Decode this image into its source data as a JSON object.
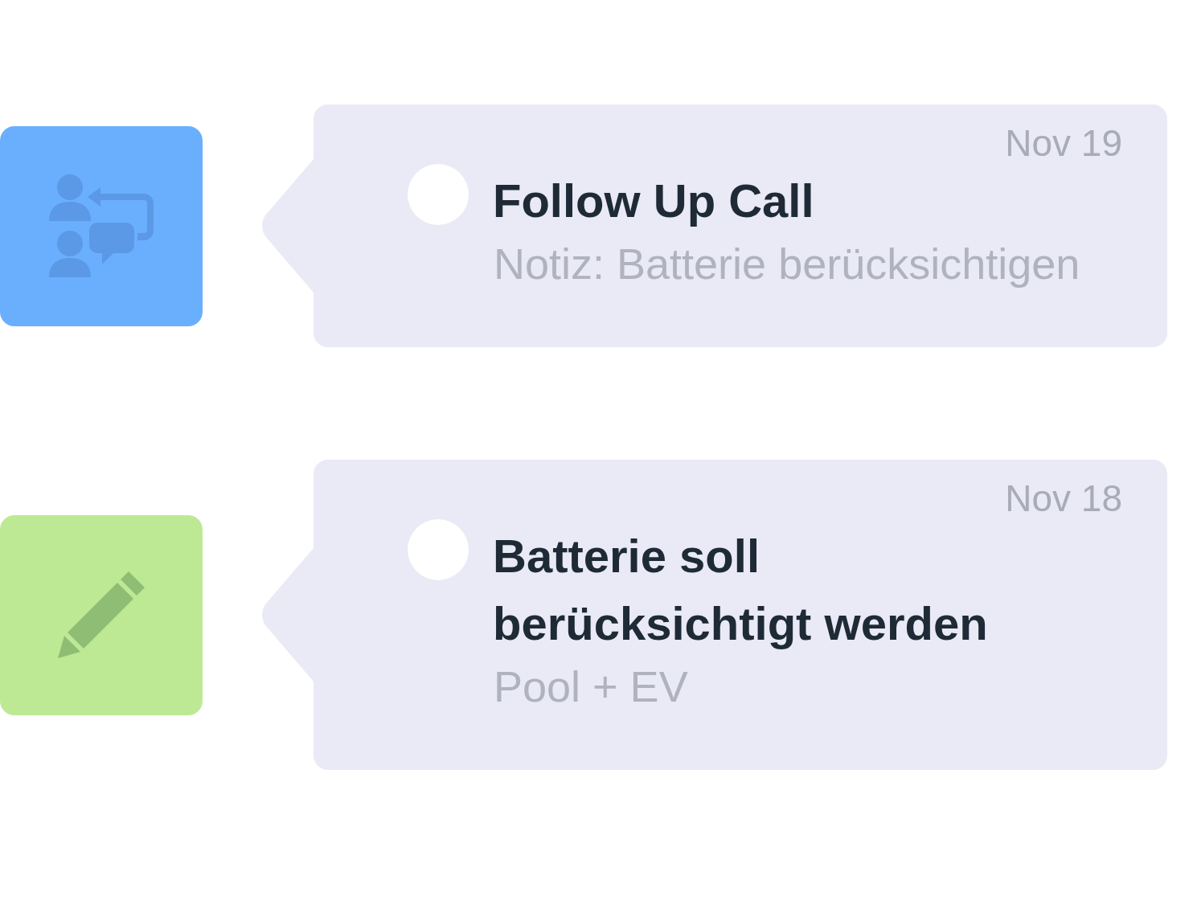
{
  "activities": [
    {
      "kind": "call",
      "color": "#6aaffe",
      "title": "Follow Up Call",
      "date": "Nov 19",
      "note": "Notiz: Batterie berücksichtigen",
      "done": false
    },
    {
      "kind": "note",
      "color": "#bde995",
      "title": "Batterie soll berücksichtigt werden",
      "date": "Nov 18",
      "note": "Pool + EV",
      "done": false
    }
  ]
}
